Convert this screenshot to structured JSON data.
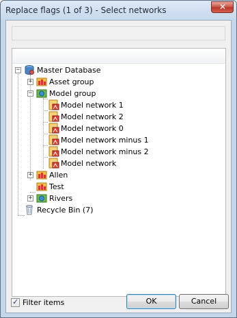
{
  "window": {
    "title": "Replace flags (1 of 3) - Select networks",
    "close_glyph": "✕"
  },
  "tree": {
    "items": [
      {
        "label": "Master Database",
        "icon": "database-icon",
        "expander": "−"
      },
      {
        "label": "Asset group",
        "icon": "asset-group-icon",
        "expander": "+"
      },
      {
        "label": "Model group",
        "icon": "model-group-icon",
        "expander": "−"
      },
      {
        "label": "Model network 1",
        "icon": "model-network-icon"
      },
      {
        "label": "Model network 2",
        "icon": "model-network-icon"
      },
      {
        "label": "Model network 0",
        "icon": "model-network-icon"
      },
      {
        "label": "Model network minus 1",
        "icon": "model-network-icon"
      },
      {
        "label": "Model network minus 2",
        "icon": "model-network-icon"
      },
      {
        "label": "Model network",
        "icon": "model-network-icon"
      },
      {
        "label": "Allen",
        "icon": "asset-group-icon",
        "expander": "+"
      },
      {
        "label": "Test",
        "icon": "asset-group-icon"
      },
      {
        "label": "Rivers",
        "icon": "model-group-icon",
        "expander": "+"
      },
      {
        "label": "Recycle Bin (7)",
        "icon": "recycle-bin-icon"
      }
    ]
  },
  "footer": {
    "filter_label": "Filter items",
    "filter_checked": true,
    "ok_label": "OK",
    "cancel_label": "Cancel"
  }
}
